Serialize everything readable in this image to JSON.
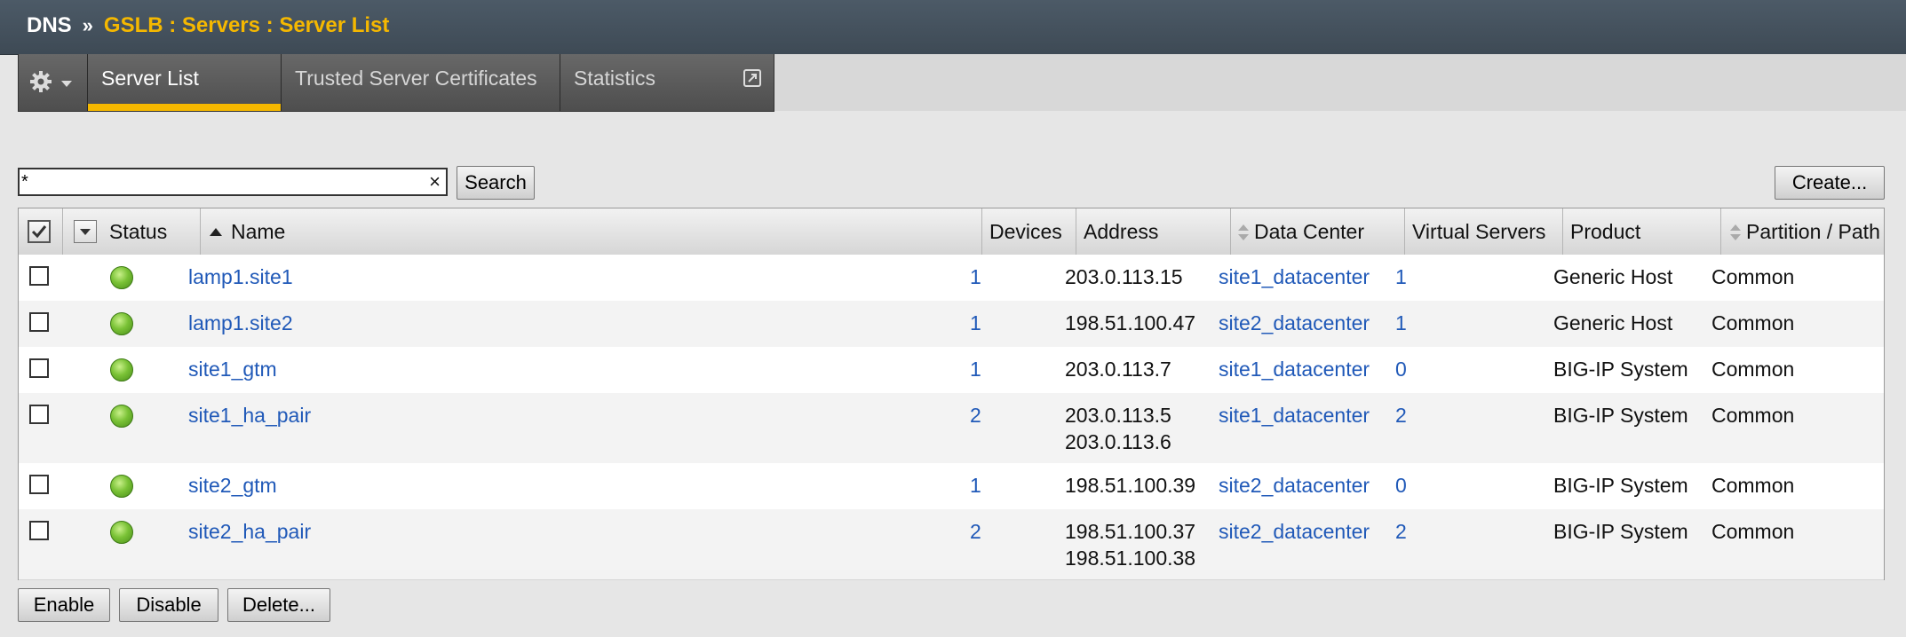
{
  "breadcrumb": {
    "root": "DNS",
    "separator": "»",
    "path": "GSLB : Servers : Server List"
  },
  "tabs": {
    "active": "Server List",
    "trusted": "Trusted Server Certificates",
    "statistics": "Statistics"
  },
  "search": {
    "value": "*",
    "clear": "×",
    "button": "Search"
  },
  "create_button": "Create...",
  "table": {
    "headers": {
      "status": "Status",
      "name": "Name",
      "devices": "Devices",
      "address": "Address",
      "data_center": "Data Center",
      "virtual_servers": "Virtual Servers",
      "product": "Product",
      "partition": "Partition / Path"
    },
    "rows": [
      {
        "name": "lamp1.site1",
        "devices": "1",
        "address": [
          "203.0.113.15"
        ],
        "data_center": "site1_datacenter",
        "virtual_servers": "1",
        "product": "Generic Host",
        "partition": "Common"
      },
      {
        "name": "lamp1.site2",
        "devices": "1",
        "address": [
          "198.51.100.47"
        ],
        "data_center": "site2_datacenter",
        "virtual_servers": "1",
        "product": "Generic Host",
        "partition": "Common"
      },
      {
        "name": "site1_gtm",
        "devices": "1",
        "address": [
          "203.0.113.7"
        ],
        "data_center": "site1_datacenter",
        "virtual_servers": "0",
        "product": "BIG-IP System",
        "partition": "Common"
      },
      {
        "name": "site1_ha_pair",
        "devices": "2",
        "address": [
          "203.0.113.5",
          "203.0.113.6"
        ],
        "data_center": "site1_datacenter",
        "virtual_servers": "2",
        "product": "BIG-IP System",
        "partition": "Common"
      },
      {
        "name": "site2_gtm",
        "devices": "1",
        "address": [
          "198.51.100.39"
        ],
        "data_center": "site2_datacenter",
        "virtual_servers": "0",
        "product": "BIG-IP System",
        "partition": "Common"
      },
      {
        "name": "site2_ha_pair",
        "devices": "2",
        "address": [
          "198.51.100.37",
          "198.51.100.38"
        ],
        "data_center": "site2_datacenter",
        "virtual_servers": "2",
        "product": "BIG-IP System",
        "partition": "Common"
      }
    ]
  },
  "actions": {
    "enable": "Enable",
    "disable": "Disable",
    "delete": "Delete..."
  },
  "colors": {
    "accent": "#f5b800",
    "link": "#2059b8",
    "status_ok": "#7ac236"
  },
  "icons": {
    "gear": "gear-icon",
    "external": "external-link-icon",
    "status": "status-available-icon"
  }
}
